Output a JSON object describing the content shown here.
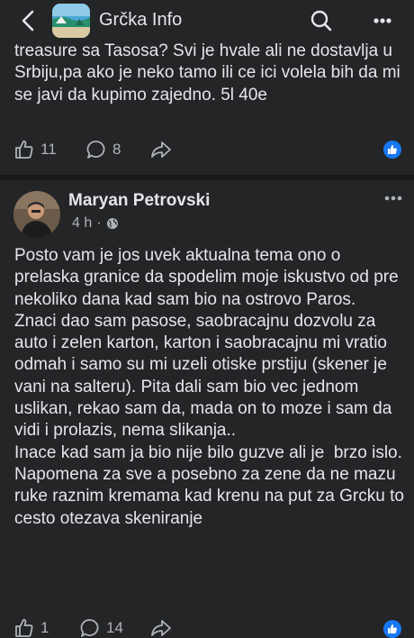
{
  "header": {
    "title": "Grčka Info",
    "back_icon": "chevron-left-icon",
    "search_icon": "search-icon",
    "more_icon": "more-vertical-icon"
  },
  "posts": [
    {
      "text": "treasure sa Tasosa? Svi je hvale ali ne dostavlja u Srbiju,pa ako je neko tamo ili ce ici volela bih da mi se javi da kupimo zajedno. 5l 40e",
      "likes": "11",
      "comments": "8"
    },
    {
      "author": "Maryan Petrovski",
      "time": "4 h",
      "privacy_icon": "globe-icon",
      "text": "Posto vam je jos uvek aktualna tema ono o prelaska granice da spodelim moje iskustvo od pre nekoliko dana kad sam bio na ostrovo Paros.\nZnaci dao sam pasose, saobracajnu dozvolu za auto i zelen karton, karton i saobracajnu mi vratio odmah i samo su mi uzeli otiske prstiju (skener je vani na salteru). Pita dali sam bio vec jednom uslikan, rekao sam da, mada on to moze i sam da vidi i prolazis, nema slikanja..\nInace kad sam ja bio nije bilo guzve ali je  brzo islo.\nNapomena za sve a posebno za zene da ne mazu ruke raznim kremama kad krenu na put za Grcku to cesto otezava skeniranje",
      "likes": "1",
      "comments": "14"
    }
  ],
  "colors": {
    "background": "#242526",
    "text": "#e4e6eb",
    "secondary": "#b0b3b8",
    "accent": "#1877f2"
  }
}
